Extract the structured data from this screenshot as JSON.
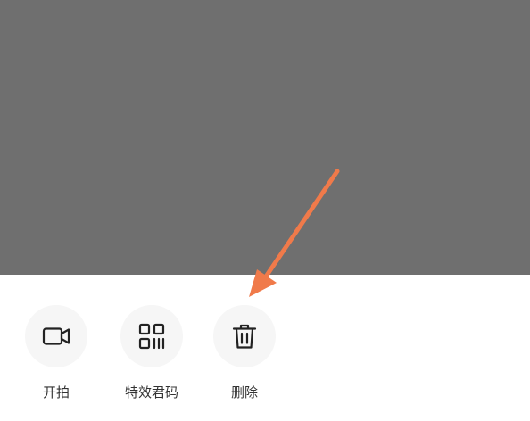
{
  "overlay": {
    "color": "#6f6f6f"
  },
  "action_sheet": {
    "actions": [
      {
        "label": "开拍",
        "icon": "video-camera-icon"
      },
      {
        "label": "特效君码",
        "icon": "qr-code-icon"
      },
      {
        "label": "删除",
        "icon": "trash-icon"
      }
    ]
  },
  "annotation": {
    "icon": "arrow-icon",
    "color": "#f07a4a"
  }
}
